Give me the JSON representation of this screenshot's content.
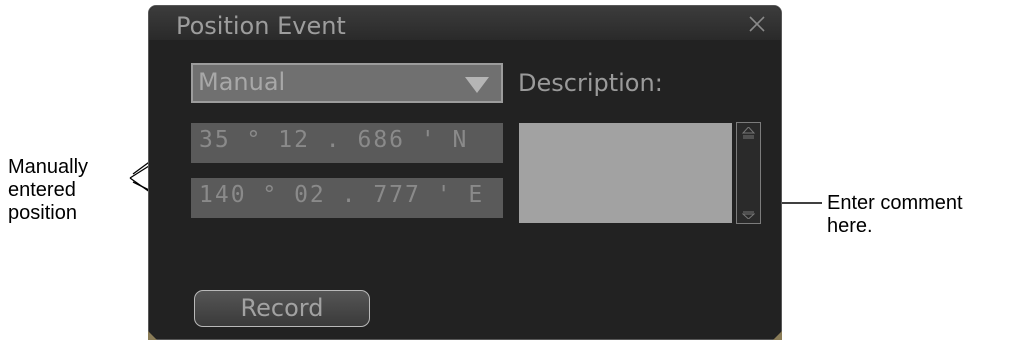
{
  "dialog": {
    "title": "Position Event",
    "close_icon": "close-icon",
    "mode_select": {
      "value": "Manual",
      "arrow_icon": "dropdown-arrow-icon"
    },
    "description_label": "Description:",
    "latitude": "35 ° 12 . 686 ' N",
    "longitude": "140 ° 02 . 777 ' E",
    "description_value": "",
    "record_label": "Record"
  },
  "callouts": {
    "left": [
      "Manually",
      "entered",
      "position"
    ],
    "right": [
      "Enter comment",
      "here."
    ]
  },
  "colors": {
    "dialog_bg": "#222222",
    "titlebar": "#333333",
    "field_bg": "#5a5a5a",
    "description_bg": "#a2a2a2",
    "text_dim": "#9a9a9a"
  }
}
